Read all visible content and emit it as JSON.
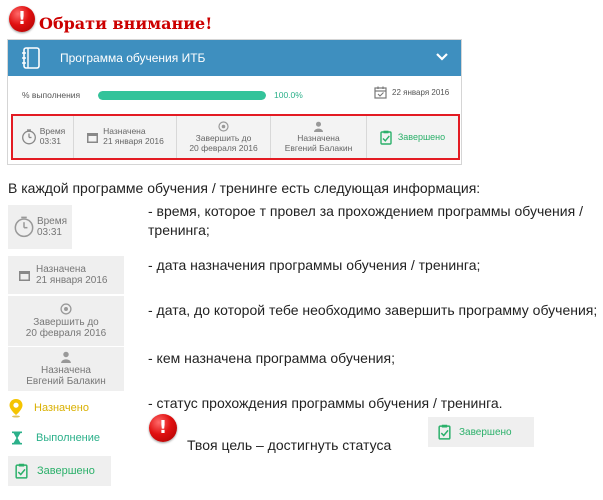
{
  "notice": {
    "heading": "Обрати внимание!",
    "badge_symbol": "!"
  },
  "course": {
    "title": "Программа обучения ИТБ",
    "progress_label": "% выполнения",
    "progress_value": "100.0%",
    "progress_fraction": 1.0,
    "due_date": "22 января 2016",
    "info": {
      "time_label": "Время",
      "time_value": "03:31",
      "assigned_label": "Назначена",
      "assigned_date": "21 января 2016",
      "finish_by_label": "Завершить до",
      "finish_by_date": "20 февраля 2016",
      "assigned_by_label": "Назначена",
      "assigned_by_name": "Евгений Балакин",
      "status": "Завершено"
    }
  },
  "explanation": {
    "heading": "В каждой программе обучения / тренинге есть следующая информация:",
    "items": [
      "- время, которое т провел за прохождением программы обучения / тренинга;",
      "- дата назначения программы обучения / тренинга;",
      "- дата, до которой тебе необходимо завершить программу обучения;",
      "- кем назначена программа обучения;",
      "- статус прохождения программы обучения / тренинга."
    ]
  },
  "statuses": [
    {
      "label": "Назначено",
      "icon": "pin-icon",
      "color": "#f5c400"
    },
    {
      "label": "Выполнение",
      "icon": "hourglass-icon",
      "color": "#2bb08a"
    },
    {
      "label": "Завершено",
      "icon": "clipboard-check-icon",
      "color": "#2bb06a"
    }
  ],
  "goal": {
    "text": "Твоя цель – достигнуть статуса",
    "badge": "Завершено"
  },
  "colors": {
    "header_blue": "#3e8fbf",
    "accent_green": "#33c39a",
    "highlight_red": "#e31b23",
    "heading_red": "#cc0000"
  }
}
